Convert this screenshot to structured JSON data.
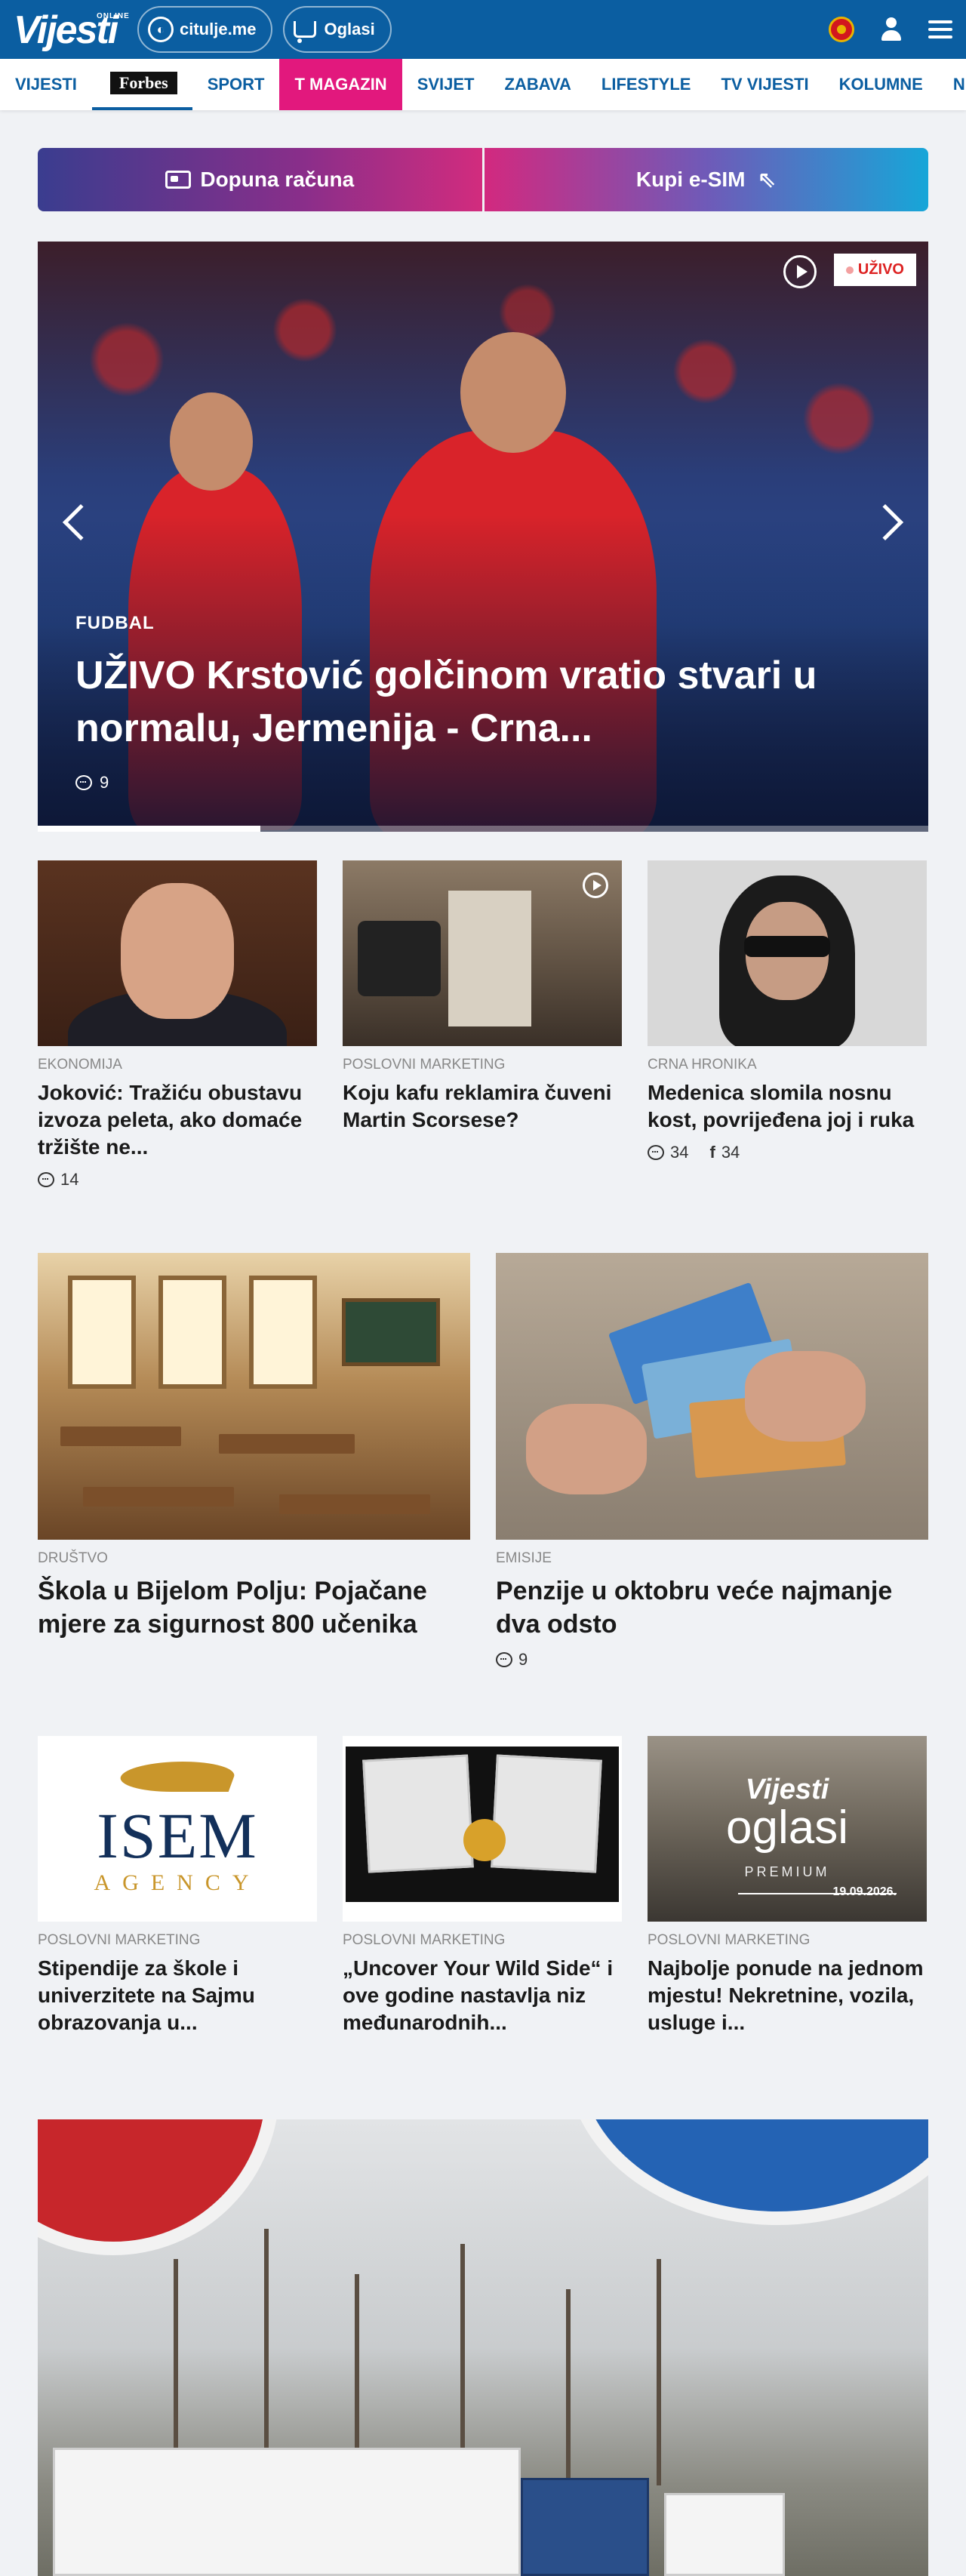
{
  "header": {
    "logo_small": "ONLINE",
    "logo_text": "Vijesti",
    "pill_citulje": "citulje.me",
    "pill_oglasi": "Oglasi"
  },
  "nav": {
    "items": [
      "VIJESTI",
      "Forbes",
      "SPORT",
      "T MAGAZIN",
      "SVIJET",
      "ZABAVA",
      "LIFESTYLE",
      "TV VIJESTI",
      "KOLUMNE",
      "N"
    ]
  },
  "promo": {
    "left_label": "Dopuna računa",
    "right_label": "Kupi e-SIM"
  },
  "hero": {
    "live_label": "UŽIVO",
    "category": "FUDBAL",
    "headline": "UŽIVO Krstović golčinom vratio stvari u normalu, Jermenija - Crna...",
    "comments": "9",
    "slide_progress": 0.25
  },
  "row1": [
    {
      "category": "EKONOMIJA",
      "title": "Joković: Tražiću obustavu izvoza peleta, ako domaće tržište ne...",
      "comments": "14"
    },
    {
      "category": "POSLOVNI MARKETING",
      "title": "Koju kafu reklamira čuveni Martin Scorsese?"
    },
    {
      "category": "CRNA HRONIKA",
      "title": "Medenica slomila nosnu kost, povrijeđena joj i ruka",
      "comments": "34",
      "shares": "34"
    }
  ],
  "row2": [
    {
      "category": "DRUŠTVO",
      "title": "Škola u Bijelom Polju: Pojačane mjere za sigurnost 800 učenika"
    },
    {
      "category": "EMISIJE",
      "title": "Penzije u oktobru veće najmanje dva odsto",
      "comments": "9"
    }
  ],
  "row3": [
    {
      "category": "POSLOVNI MARKETING",
      "title": "Stipendije za škole i univerzitete na Sajmu obrazovanja u...",
      "logo_line1": "ISEM",
      "logo_line2": "AGENCY"
    },
    {
      "category": "POSLOVNI MARKETING",
      "title": "„Uncover Your Wild Side“ i ove godine nastavlja niz međunarodnih..."
    },
    {
      "category": "POSLOVNI MARKETING",
      "title": "Najbolje ponude na jednom mjestu! Nekretnine, vozila, usluge i...",
      "img_brand": "Vijesti",
      "img_word": "oglasi",
      "img_tag": "PREMIUM",
      "img_date": "19.09.2026."
    }
  ],
  "colors": {
    "brand_blue": "#0b5ea1",
    "tmagazin_pink": "#e2187d",
    "live_red": "#dd2222"
  }
}
